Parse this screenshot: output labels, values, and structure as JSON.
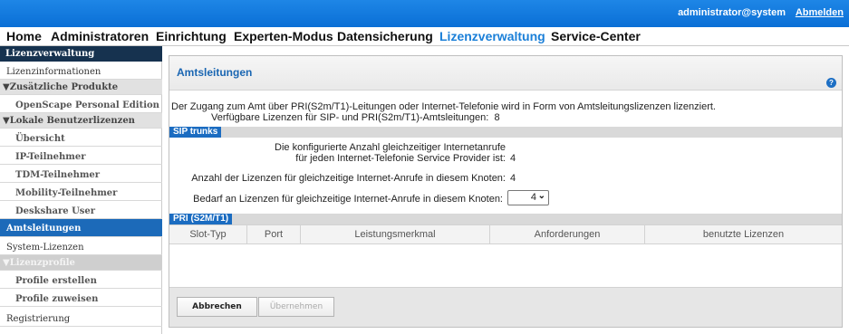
{
  "topbar": {
    "user": "administrator@system",
    "logout": "Abmelden"
  },
  "nav": [
    {
      "label": "Home",
      "active": false
    },
    {
      "label": "Administratoren",
      "active": false
    },
    {
      "label": "Einrichtung",
      "active": false
    },
    {
      "label": "Experten-Modus",
      "active": false
    },
    {
      "label": "Datensicherung",
      "active": false
    },
    {
      "label": "Lizenzverwaltung",
      "active": true
    },
    {
      "label": "Service-Center",
      "active": false
    }
  ],
  "sidebar": {
    "header": "Lizenzverwaltung",
    "items": [
      {
        "label": "Lizenzinformationen"
      },
      {
        "label": "▼Zusätzliche Produkte"
      },
      {
        "label": "OpenScape Personal Edition"
      },
      {
        "label": "▼Lokale Benutzerlizenzen"
      },
      {
        "label": "Übersicht"
      },
      {
        "label": "IP-Teilnehmer"
      },
      {
        "label": "TDM-Teilnehmer"
      },
      {
        "label": "Mobility-Teilnehmer"
      },
      {
        "label": "Deskshare User"
      },
      {
        "label": "Amtsleitungen"
      },
      {
        "label": "System-Lizenzen"
      },
      {
        "label": "▼Lizenzprofile"
      },
      {
        "label": "Profile erstellen"
      },
      {
        "label": "Profile zuweisen"
      },
      {
        "label": "Registrierung"
      }
    ]
  },
  "panel": {
    "title": "Amtsleitungen",
    "help_icon": "?",
    "intro_line1": "Der Zugang zum Amt über PRI(S2m/T1)-Leitungen oder Internet-Telefonie wird in Form von Amtsleitungslizenzen lizenziert.",
    "intro_line2": "Verfügbare Lizenzen für SIP- und PRI(S2m/T1)-Amtsleitungen:",
    "available_licenses": "8",
    "sip_section": "SIP trunks",
    "configured_line1": "Die konfigurierte Anzahl gleichzeitiger Internetanrufe",
    "configured_line2": "für jeden Internet-Telefonie Service Provider ist:",
    "configured_value": "4",
    "licenses_node_label": "Anzahl der Lizenzen für gleichzeitige Internet-Anrufe in diesem Knoten:",
    "licenses_node_value": "4",
    "demand_label": "Bedarf an Lizenzen für gleichzeitige Internet-Anrufe in diesem Knoten:",
    "demand_value": "4",
    "pri_section": "PRI (S2M/T1)",
    "columns": [
      "Slot-Typ",
      "Port",
      "Leistungsmerkmal",
      "Anforderungen",
      "benutzte Lizenzen"
    ],
    "cancel": "Abbrechen",
    "apply": "Übernehmen"
  }
}
